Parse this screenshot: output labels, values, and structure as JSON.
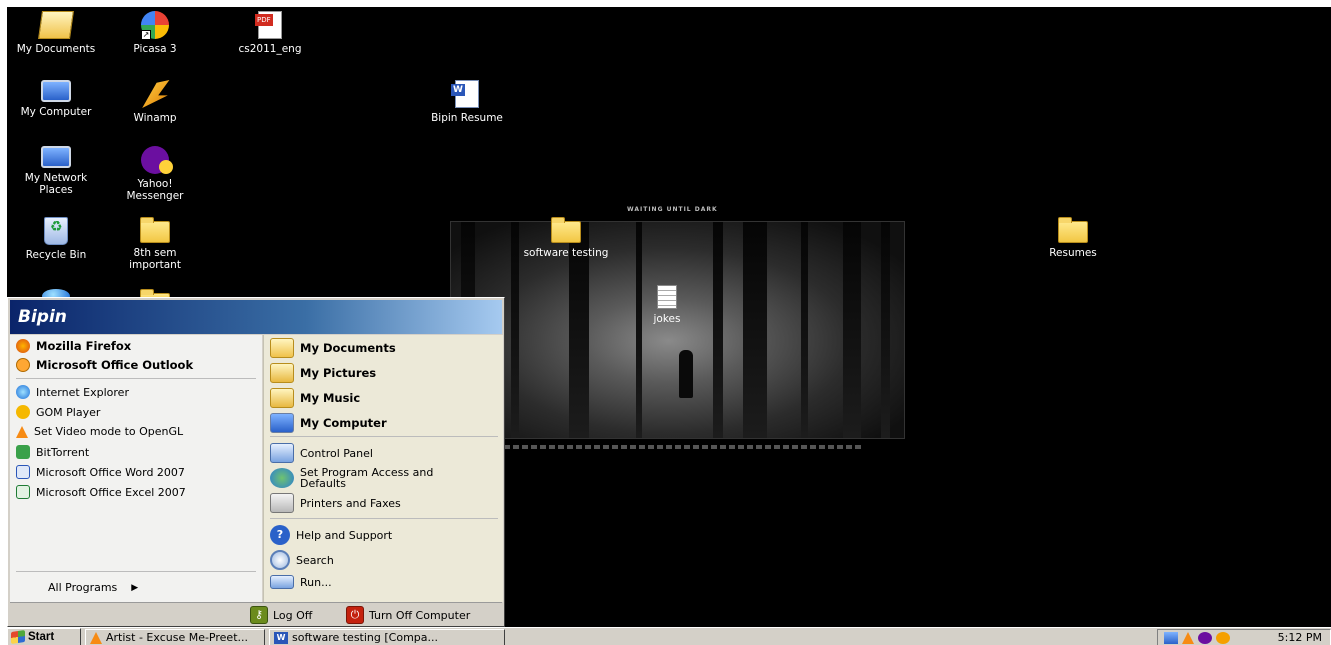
{
  "desktop": {
    "wallpaper_title": "WAITING UNTIL DARK",
    "icons": [
      {
        "label": "My Documents"
      },
      {
        "label": "Picasa 3"
      },
      {
        "label": "cs2011_eng"
      },
      {
        "label": "My Computer"
      },
      {
        "label": "Winamp"
      },
      {
        "label": "Bipin Resume"
      },
      {
        "label": "My Network Places"
      },
      {
        "label": "Yahoo! Messenger"
      },
      {
        "label": "Recycle Bin"
      },
      {
        "label": "8th sem important"
      },
      {
        "label": "software testing"
      },
      {
        "label": "jokes"
      },
      {
        "label": "Resumes"
      }
    ]
  },
  "start_menu": {
    "user_name": "Bipin",
    "pinned": [
      {
        "label": "Mozilla Firefox",
        "icon": "firefox-icon"
      },
      {
        "label": "Microsoft Office Outlook",
        "icon": "outlook-icon"
      }
    ],
    "recent": [
      {
        "label": "Internet Explorer",
        "icon": "ie-icon"
      },
      {
        "label": "GOM Player",
        "icon": "gom-icon"
      },
      {
        "label": "Set Video mode to OpenGL",
        "icon": "vlc-icon"
      },
      {
        "label": "BitTorrent",
        "icon": "bittorrent-icon"
      },
      {
        "label": "Microsoft Office Word 2007",
        "icon": "word-icon"
      },
      {
        "label": "Microsoft Office Excel 2007",
        "icon": "excel-icon"
      }
    ],
    "all_programs": "All Programs",
    "places": [
      {
        "label": "My Documents"
      },
      {
        "label": "My Pictures"
      },
      {
        "label": "My Music"
      },
      {
        "label": "My Computer"
      }
    ],
    "settings": [
      {
        "label": "Control Panel"
      },
      {
        "label": "Set Program Access and Defaults"
      },
      {
        "label": "Printers and Faxes"
      }
    ],
    "tools": [
      {
        "label": "Help and Support"
      },
      {
        "label": "Search"
      },
      {
        "label": "Run..."
      }
    ],
    "log_off": "Log Off",
    "turn_off": "Turn Off Computer"
  },
  "taskbar": {
    "start_label": "Start",
    "tasks": [
      {
        "label": "Artist - Excuse Me-Preet..."
      },
      {
        "label": "software testing [Compa..."
      }
    ],
    "clock": "5:12 PM"
  }
}
